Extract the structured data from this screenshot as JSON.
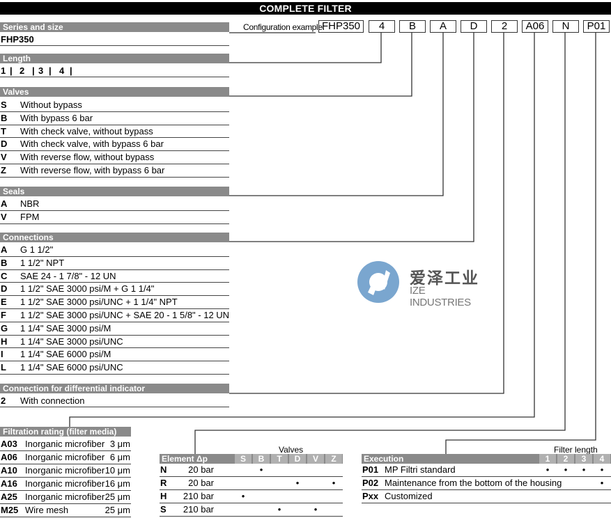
{
  "title": "COMPLETE FILTER",
  "config": {
    "label": "Configuration example:",
    "codes": [
      "FHP350",
      "4",
      "B",
      "A",
      "D",
      "2",
      "A06",
      "N",
      "P01"
    ]
  },
  "series": {
    "header": "Series and size",
    "value": "FHP350"
  },
  "length": {
    "header": "Length",
    "values": [
      "1",
      "2",
      "3",
      "4"
    ]
  },
  "valves": {
    "header": "Valves",
    "items": [
      {
        "code": "S",
        "desc": "Without bypass"
      },
      {
        "code": "B",
        "desc": "With bypass 6 bar"
      },
      {
        "code": "T",
        "desc": "With check valve, without bypass"
      },
      {
        "code": "D",
        "desc": "With check valve, with bypass 6 bar"
      },
      {
        "code": "V",
        "desc": "With reverse flow, without bypass"
      },
      {
        "code": "Z",
        "desc": "With reverse flow, with bypass 6 bar"
      }
    ]
  },
  "seals": {
    "header": "Seals",
    "items": [
      {
        "code": "A",
        "desc": "NBR"
      },
      {
        "code": "V",
        "desc": "FPM"
      }
    ]
  },
  "connections": {
    "header": "Connections",
    "items": [
      {
        "code": "A",
        "desc": "G 1 1/2\""
      },
      {
        "code": "B",
        "desc": "1 1/2\" NPT"
      },
      {
        "code": "C",
        "desc": "SAE 24 - 1 7/8\" - 12 UN"
      },
      {
        "code": "D",
        "desc": "1 1/2\" SAE 3000 psi/M + G 1 1/4\""
      },
      {
        "code": "E",
        "desc": "1 1/2\" SAE 3000 psi/UNC + 1 1/4\" NPT"
      },
      {
        "code": "F",
        "desc": "1 1/2\" SAE 3000 psi/UNC + SAE 20 - 1 5/8\" - 12 UN"
      },
      {
        "code": "G",
        "desc": "1 1/4\" SAE 3000 psi/M"
      },
      {
        "code": "H",
        "desc": "1 1/4\" SAE 3000 psi/UNC"
      },
      {
        "code": "I",
        "desc": "1 1/4\" SAE 6000 psi/M"
      },
      {
        "code": "L",
        "desc": "1 1/4\" SAE 6000 psi/UNC"
      }
    ]
  },
  "diff_indicator": {
    "header": "Connection for differential indicator",
    "items": [
      {
        "code": "2",
        "desc": "With connection"
      }
    ]
  },
  "filtration": {
    "header": "Filtration rating (filter media)",
    "items": [
      {
        "code": "A03",
        "desc": "Inorganic microfiber",
        "rating": "3 μm"
      },
      {
        "code": "A06",
        "desc": "Inorganic microfiber",
        "rating": "6 μm"
      },
      {
        "code": "A10",
        "desc": "Inorganic microfiber",
        "rating": "10 μm"
      },
      {
        "code": "A16",
        "desc": "Inorganic microfiber",
        "rating": "16 μm"
      },
      {
        "code": "A25",
        "desc": "Inorganic microfiber",
        "rating": "25 μm"
      },
      {
        "code": "M25",
        "desc": "Wire mesh",
        "rating": "25 μm"
      }
    ]
  },
  "element": {
    "group_label": "Valves",
    "header": "Element Δp",
    "columns": [
      "S",
      "B",
      "T",
      "D",
      "V",
      "Z"
    ],
    "rows": [
      {
        "code": "N",
        "value": "20 bar",
        "marks": [
          false,
          true,
          false,
          false,
          false,
          false
        ]
      },
      {
        "code": "R",
        "value": "20 bar",
        "marks": [
          false,
          false,
          false,
          true,
          false,
          true
        ]
      },
      {
        "code": "H",
        "value": "210 bar",
        "marks": [
          true,
          false,
          false,
          false,
          false,
          false
        ]
      },
      {
        "code": "S",
        "value": "210 bar",
        "marks": [
          false,
          false,
          true,
          false,
          true,
          false
        ]
      }
    ],
    "mark_symbol": "•"
  },
  "execution": {
    "group_label": "Filter length",
    "header": "Execution",
    "columns": [
      "1",
      "2",
      "3",
      "4"
    ],
    "rows": [
      {
        "code": "P01",
        "desc": "MP Filtri standard",
        "marks": [
          true,
          true,
          true,
          true
        ]
      },
      {
        "code": "P02",
        "desc": "Maintenance from the bottom of the housing",
        "marks": [
          false,
          false,
          false,
          true
        ]
      },
      {
        "code": "Pxx",
        "desc": "Customized",
        "marks": [
          false,
          false,
          false,
          false
        ]
      }
    ],
    "mark_symbol": "•"
  },
  "watermark": {
    "name_cn": "爱泽工业",
    "name_en": "IZE INDUSTRIES",
    "color": "#7aa6cf"
  }
}
